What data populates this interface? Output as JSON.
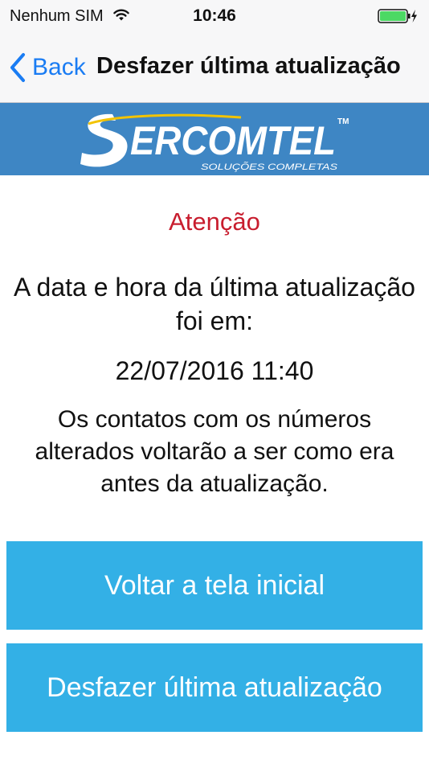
{
  "status_bar": {
    "carrier": "Nenhum SIM",
    "time": "10:46",
    "battery_color": "#4cd964"
  },
  "nav": {
    "back_label": "Back",
    "title": "Desfazer última atualização",
    "back_color": "#1a7cf3"
  },
  "banner": {
    "logo_text": "SERCOMTEL",
    "logo_tagline": "SOLUÇÕES COMPLETAS",
    "logo_tm": "TM",
    "background_color": "#3e86c4"
  },
  "content": {
    "attention_title": "Atenção",
    "attention_color": "#c81d2e",
    "last_update_text": "A data e hora da última atualização foi em:",
    "last_update_date": "22/07/2016 11:40",
    "info_text": "Os contatos com os números alterados voltarão a ser como era antes da atualização."
  },
  "buttons": {
    "home_label": "Voltar a tela inicial",
    "undo_label": "Desfazer última atualização",
    "color": "#33b0e6"
  }
}
